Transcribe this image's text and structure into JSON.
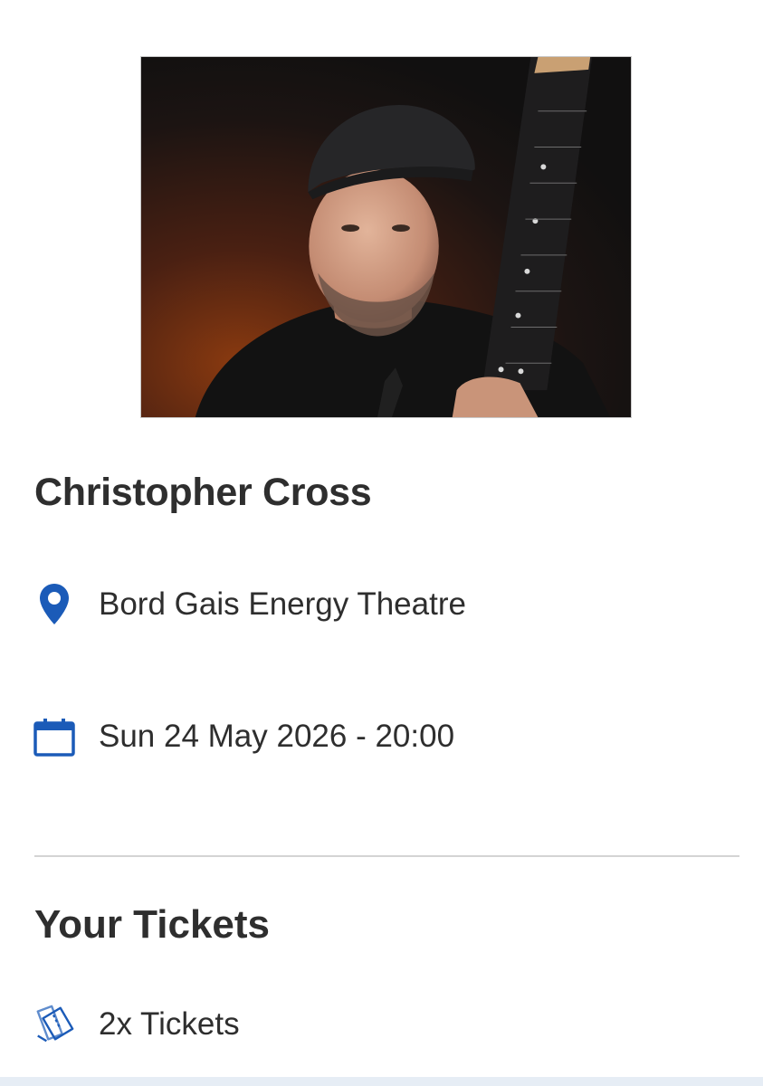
{
  "event": {
    "name": "Christopher Cross",
    "venue": "Bord Gais Energy Theatre",
    "datetime": "Sun 24 May 2026 - 20:00"
  },
  "tickets_section": {
    "title": "Your Tickets",
    "quantity_label": "2x Tickets"
  },
  "icons": {
    "venue": "map-pin-icon",
    "date": "calendar-icon",
    "tickets": "tickets-icon"
  },
  "colors": {
    "accent": "#1b5bb8",
    "text": "#2e2e2e",
    "divider": "#d4d4d4"
  }
}
